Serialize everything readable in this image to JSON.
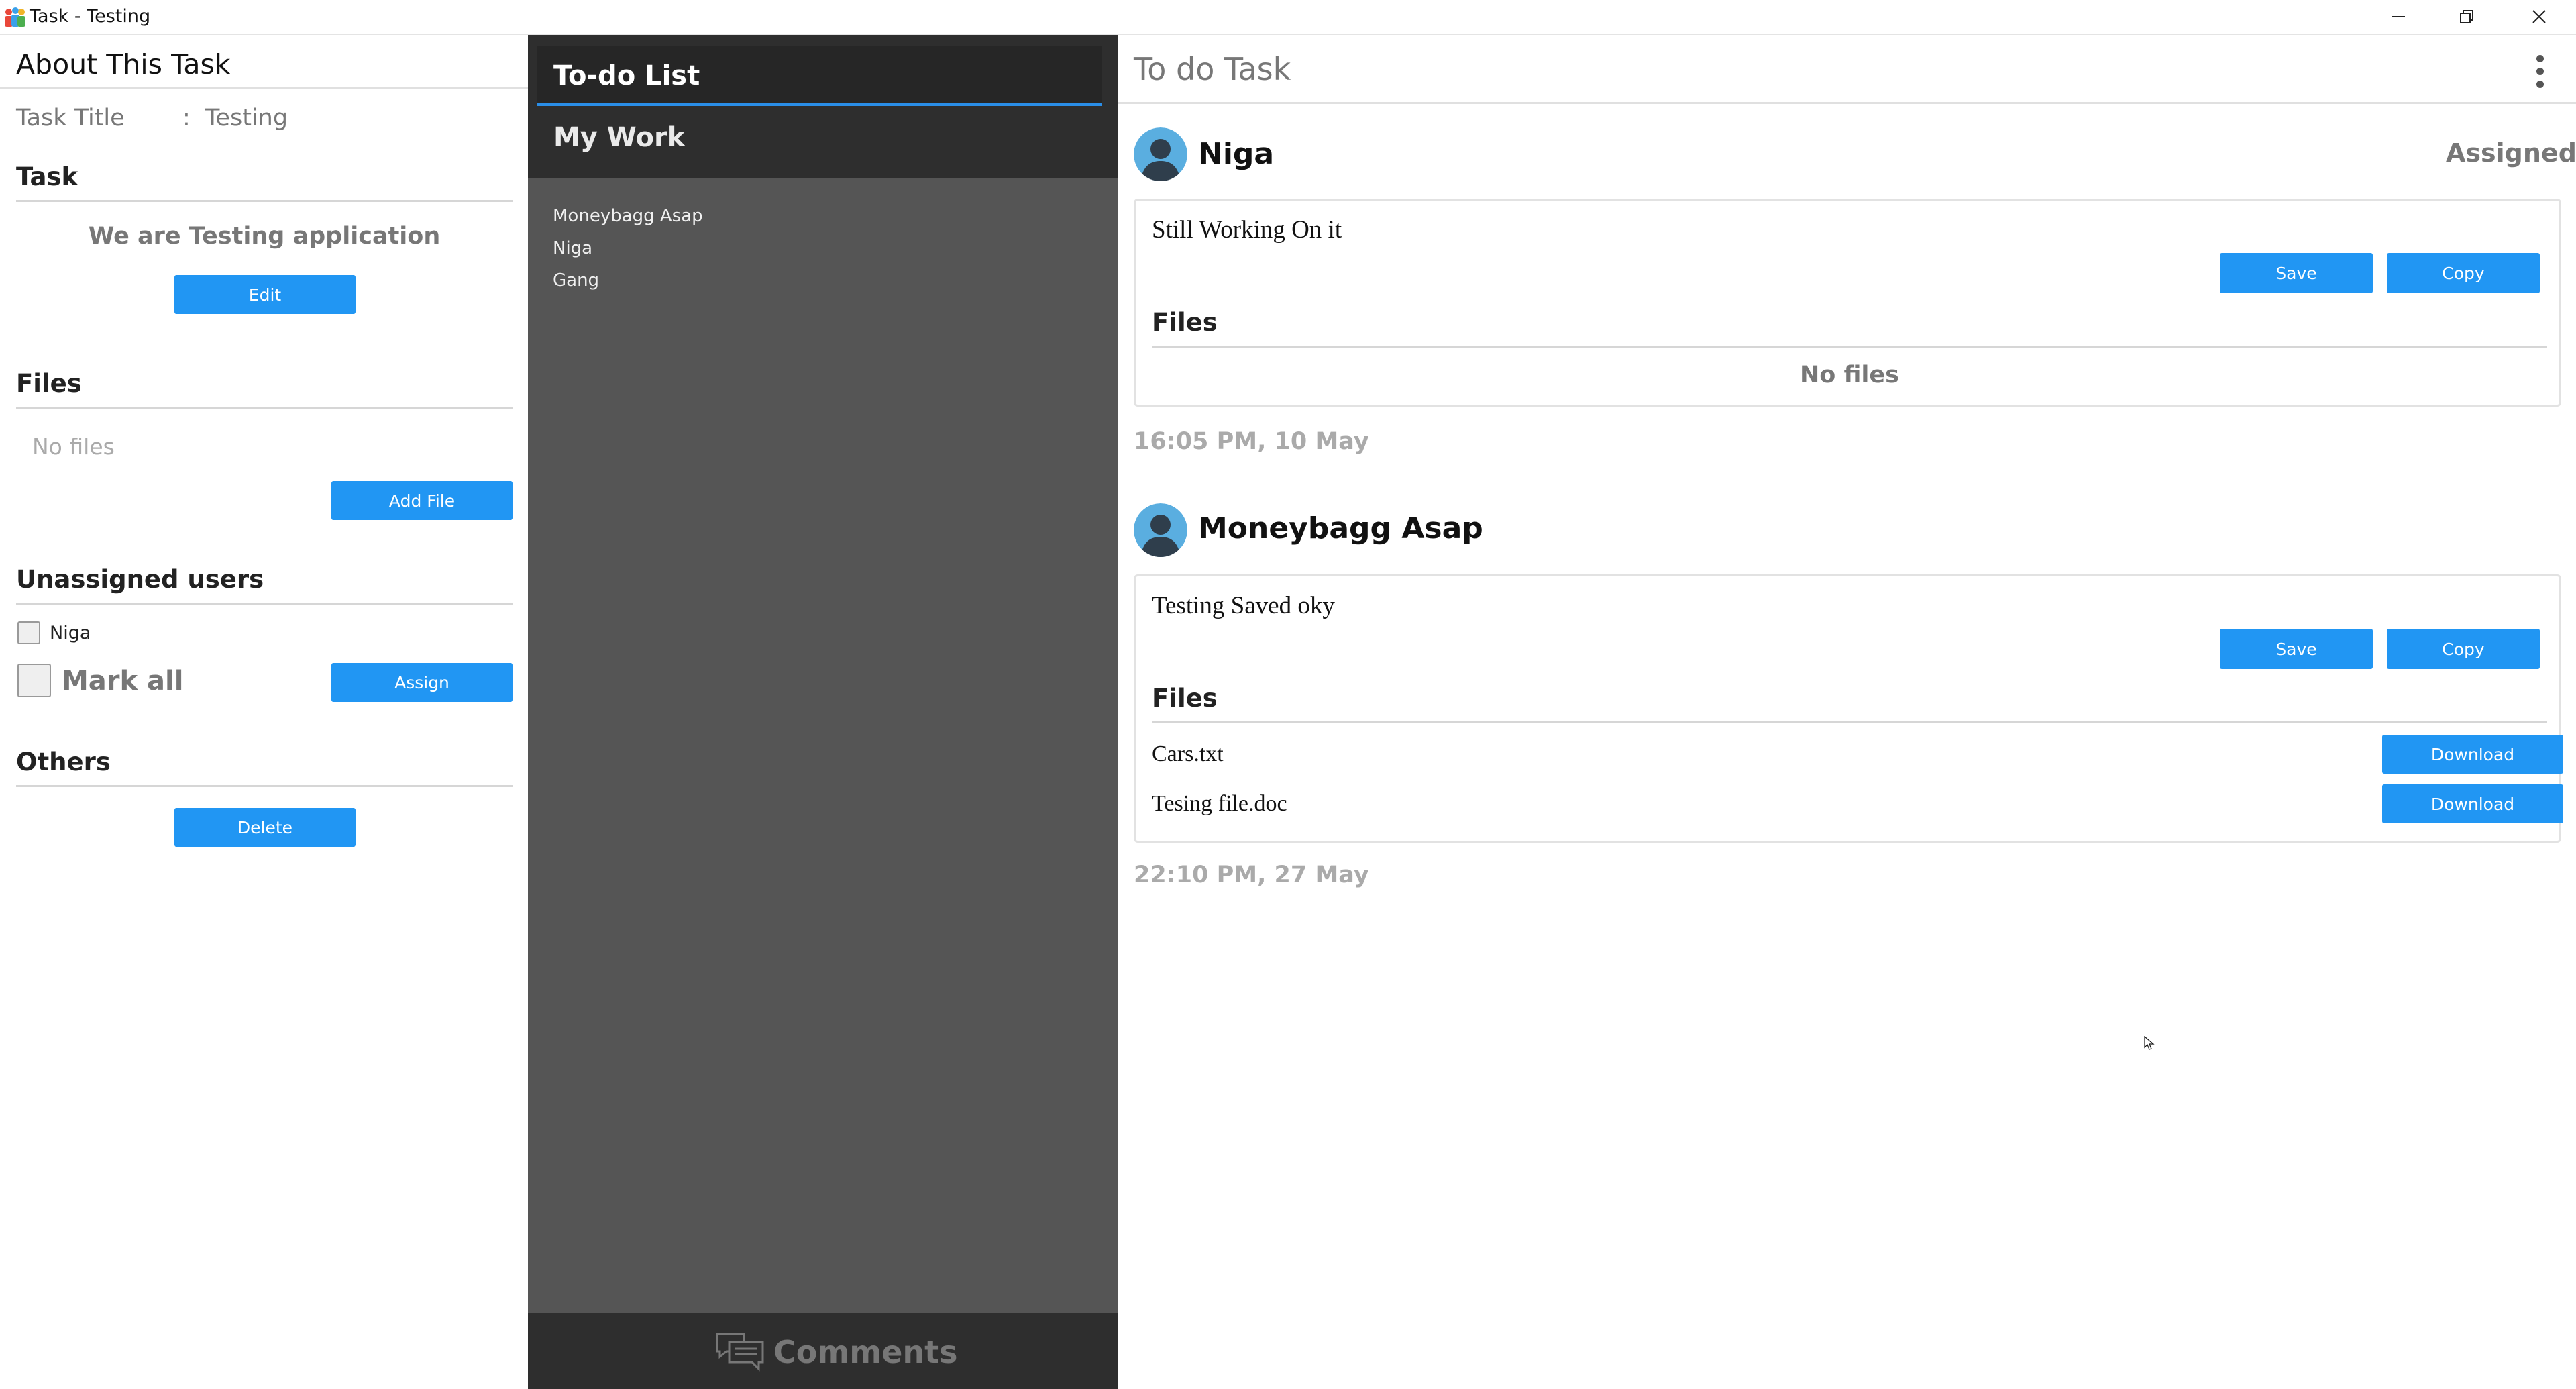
{
  "window": {
    "title": "Task - Testing"
  },
  "about": {
    "title": "About This Task",
    "task_title_label": "Task Title",
    "task_title_sep": ":",
    "task_title_value": "Testing",
    "task_section": {
      "heading": "Task",
      "description": "We are Testing application",
      "edit_label": "Edit"
    },
    "files_section": {
      "heading": "Files",
      "empty_text": "No files",
      "add_file_label": "Add File"
    },
    "unassigned_section": {
      "heading": "Unassigned users",
      "users": [
        {
          "name": "Niga",
          "checked": false
        }
      ],
      "mark_all_label": "Mark all",
      "assign_label": "Assign"
    },
    "others_section": {
      "heading": "Others",
      "delete_label": "Delete"
    }
  },
  "middle": {
    "tabs": [
      {
        "label": "To-do List",
        "active": true
      },
      {
        "label": "My Work",
        "active": false
      }
    ],
    "members": [
      "Moneybagg Asap",
      "Niga",
      "Gang"
    ],
    "comments_label": "Comments"
  },
  "detail": {
    "title": "To do Task",
    "comments": [
      {
        "author": "Niga",
        "status": "Assigned",
        "text": "Still Working On it",
        "save_label": "Save",
        "copy_label": "Copy",
        "files_heading": "Files",
        "files_empty": "No files",
        "files": [],
        "timestamp": "16:05 PM,  10 May"
      },
      {
        "author": "Moneybagg Asap",
        "status": "",
        "text": "Testing Saved oky",
        "save_label": "Save",
        "copy_label": "Copy",
        "files_heading": "Files",
        "files": [
          {
            "name": "Cars.txt",
            "action_label": "Download"
          },
          {
            "name": "Tesing file.doc",
            "action_label": "Download"
          }
        ],
        "timestamp": "22:10 PM,  27 May"
      }
    ]
  },
  "colors": {
    "accent": "#2196f3",
    "tab_underline": "#2a8ee8",
    "middle_bg": "#555555",
    "middle_header_bg": "#2e2e2e"
  },
  "icons": {
    "app": "app-icon",
    "minimize": "minimize-icon",
    "maximize": "restore-icon",
    "close": "close-icon",
    "menu": "kebab-menu-icon",
    "avatar": "user-avatar-icon",
    "comments": "comments-icon"
  }
}
